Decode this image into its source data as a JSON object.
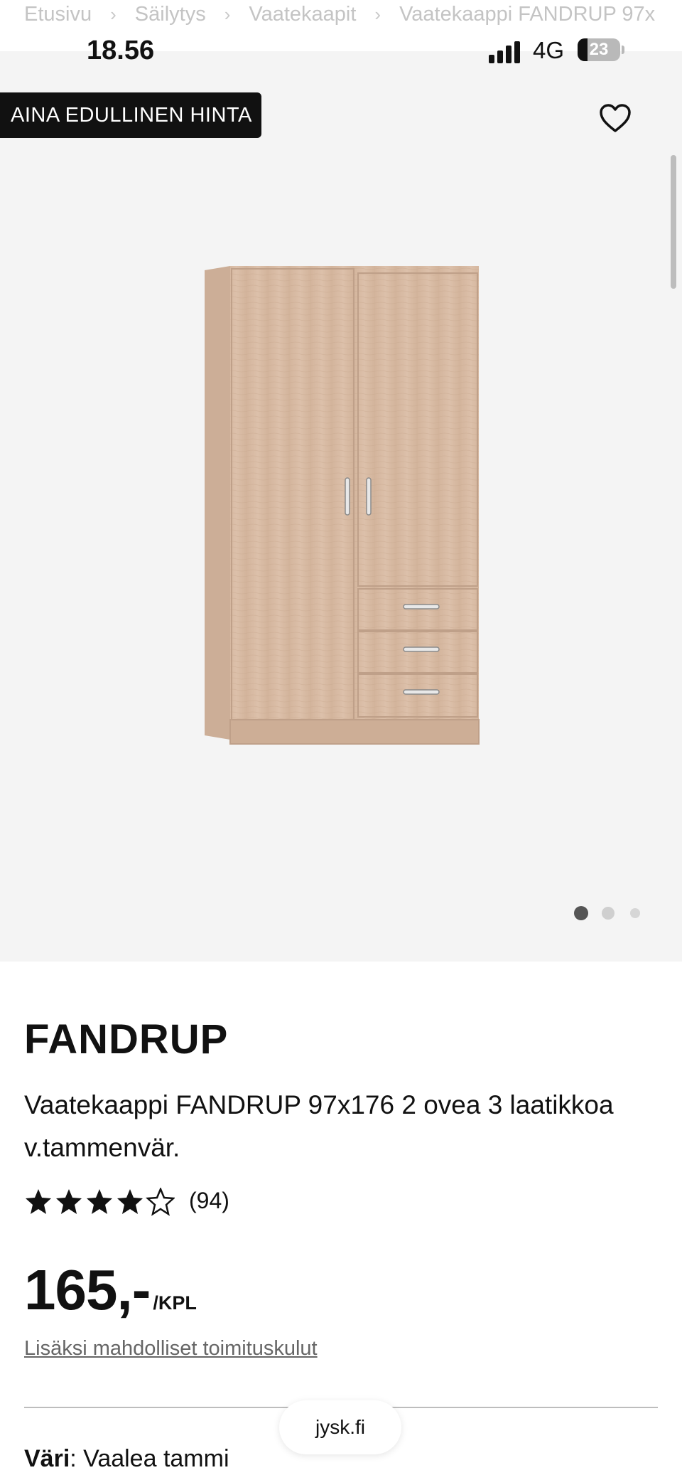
{
  "breadcrumb": {
    "items": [
      "Etusivu",
      "Säilytys",
      "Vaatekaapit",
      "Vaatekaappi FANDRUP 97x"
    ],
    "separator": "›"
  },
  "status": {
    "time": "18.56",
    "network": "4G",
    "battery": "23"
  },
  "gallery": {
    "badge": "AINA EDULLINEN HINTA",
    "image_alt": "wardrobe",
    "dots_total": 3,
    "active_dot": 1
  },
  "product": {
    "brand": "FANDRUP",
    "description": "Vaatekaappi FANDRUP 97x176 2 ovea 3 laatikkoa v.tammenvär.",
    "rating": 4.5,
    "review_count": "(94)",
    "price": "165,-",
    "price_unit": "/KPL",
    "shipping_note": "Lisäksi mahdolliset toimituskulut",
    "color_label": "Väri",
    "color_value": ": Vaalea tammi"
  },
  "browser": {
    "domain": "jysk.fi"
  },
  "colors": {
    "badge_bg": "#111111",
    "gallery_bg": "#f4f4f4",
    "wood": "#d9bca5"
  }
}
